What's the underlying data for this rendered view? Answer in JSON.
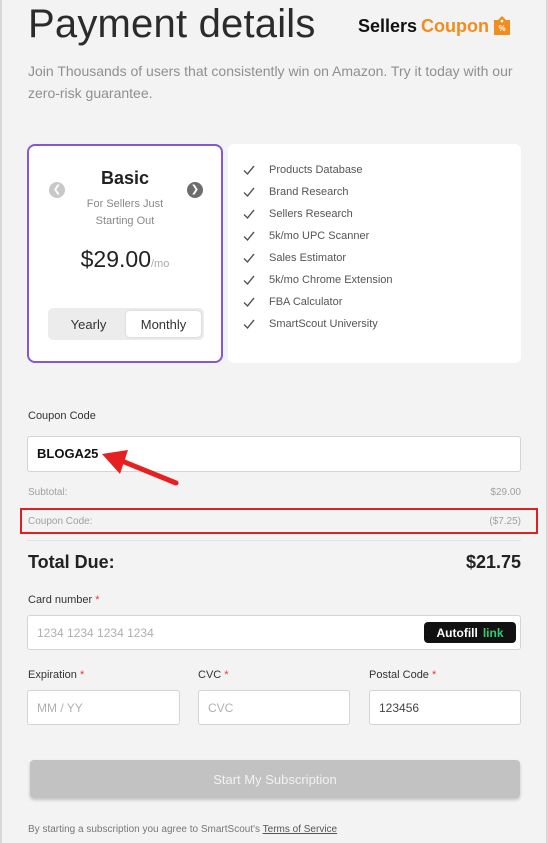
{
  "header": {
    "title": "Payment details",
    "brand_name": "Sellers",
    "brand_accent": "Coupon",
    "brand_color": "#f28c1c",
    "subtitle": "Join Thousands of users that consistently win on Amazon. Try it today with our zero-risk guarantee."
  },
  "plan": {
    "name": "Basic",
    "description": "For Sellers Just Starting Out",
    "price": "$29.00",
    "period": "/mo",
    "accent_color": "#8457d6",
    "billing_options": [
      "Yearly",
      "Monthly"
    ],
    "selected_billing": "Monthly"
  },
  "features": [
    "Products Database",
    "Brand Research",
    "Sellers Research",
    "5k/mo UPC Scanner",
    "Sales Estimator",
    "5k/mo Chrome Extension",
    "FBA Calculator",
    "SmartScout University"
  ],
  "coupon": {
    "label": "Coupon Code",
    "value": "BLOGA25"
  },
  "summary": {
    "subtotal_label": "Subtotal:",
    "subtotal_value": "$29.00",
    "coupon_label": "Coupon Code:",
    "coupon_value": "($7.25)",
    "highlight_color": "#e02020",
    "total_label": "Total Due:",
    "total_value": "$21.75"
  },
  "card": {
    "number_label": "Card number",
    "number_placeholder": "1234 1234 1234 1234",
    "autofill_label": "Autofill",
    "autofill_link": "link",
    "expiration_label": "Expiration",
    "expiration_placeholder": "MM / YY",
    "cvc_label": "CVC",
    "cvc_placeholder": "CVC",
    "postal_label": "Postal Code",
    "postal_value": "123456",
    "required_mark": "*"
  },
  "submit_label": "Start My Subscription",
  "terms": {
    "text": "By starting a subscription you agree to SmartScout's",
    "link": "Terms of Service"
  }
}
